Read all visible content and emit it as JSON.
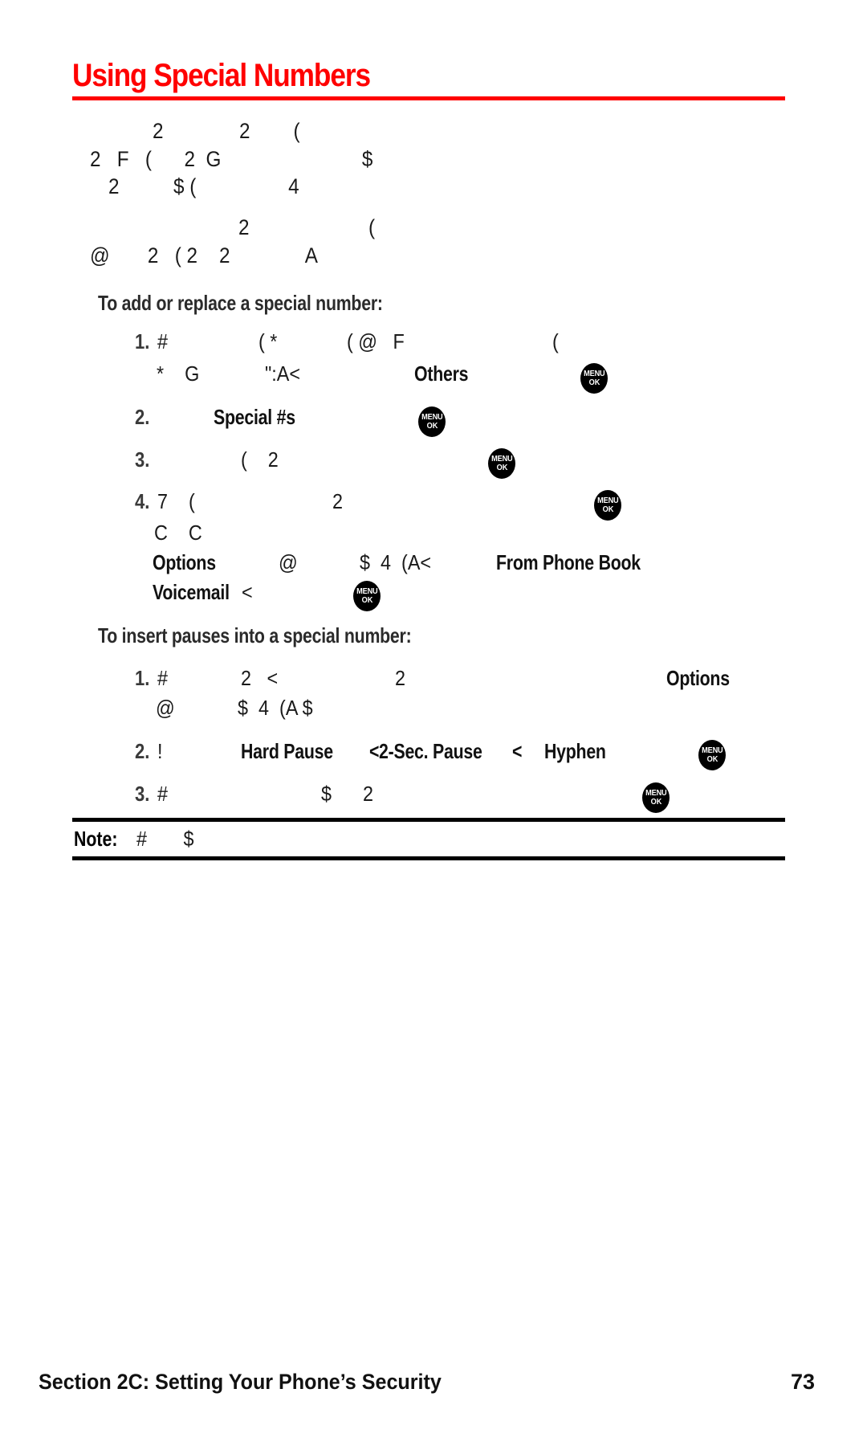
{
  "document": {
    "title": "Using Special Numbers",
    "title_color": "#ff0000",
    "rule_color": "#ff0000",
    "page_number": "73",
    "footer": "Section 2C: Setting Your Phone’s Security"
  },
  "intro": {
    "lines": [
      "2              2        (",
      "2   F   (      2  G                          $",
      "2          $ (                 4"
    ]
  },
  "intro2": {
    "lines": [
      "2                      (",
      "@       2   ( 2    2              A"
    ]
  },
  "section_add": {
    "heading": "To add or replace a special number:",
    "items": [
      {
        "num": "1.",
        "line1_a": "#",
        "line1_b": "( *",
        "line1_c": "( @   F",
        "line1_d": "(",
        "line2_a": "*    G",
        "line2_b": "\":A<",
        "line2_bold": "Others",
        "line2_icon": "menu-ok-key"
      },
      {
        "num": "2.",
        "bold": "Special #s",
        "icon": "menu-ok-key"
      },
      {
        "num": "3.",
        "text": "(    2",
        "icon": "menu-ok-key"
      },
      {
        "num": "4.",
        "line1_a": "7    (",
        "line1_b": "2",
        "line1_icon": "menu-ok-key",
        "line2": "C    C",
        "line3_bold1": "Options",
        "line3_a": "@",
        "line3_b": "$  4  (A<",
        "line3_bold2": "From Phone Book",
        "line4_bold": "Voicemail",
        "line4_a": "<",
        "line4_icon": "menu-ok-key"
      }
    ]
  },
  "section_pauses": {
    "heading": "To insert pauses into a special number:",
    "items": [
      {
        "num": "1.",
        "line1_a": "#",
        "line1_b": "2   <",
        "line1_c": "2",
        "line1_bold": "Options",
        "line2_a": "@",
        "line2_b": "$  4  (A $"
      },
      {
        "num": "2.",
        "text_a": "!",
        "bold1": "Hard Pause",
        "sep1": "<",
        "bold2": "2-Sec. Pause",
        "sep2": "<",
        "bold3": "Hyphen",
        "icon": "menu-ok-key"
      },
      {
        "num": "3.",
        "line_a": "#",
        "line_b": "$      2",
        "icon": "menu-ok-key"
      }
    ]
  },
  "note": {
    "label": "Note:",
    "text": "#       $"
  },
  "icons": {
    "menu_ok": {
      "top": "MENU",
      "bottom": "OK"
    }
  }
}
